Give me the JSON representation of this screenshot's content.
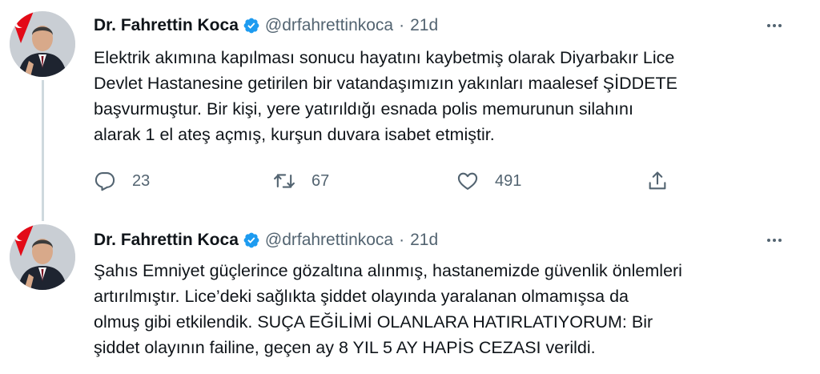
{
  "tweets": [
    {
      "author_name": "Dr. Fahrettin Koca",
      "handle": "@drfahrettinkoca",
      "separator": "·",
      "time": "21d",
      "lines": [
        "Elektrik akımına kapılması sonucu hayatını kaybetmiş olarak Diyarbakır Lice",
        "Devlet Hastanesine getirilen bir vatandaşımızın yakınları maalesef ŞİDDETE",
        "başvurmuştur. Bir kişi, yere yatırıldığı esnada polis memurunun silahını",
        "alarak 1 el ateş açmış, kurşun duvara isabet etmiştir."
      ],
      "replies": "23",
      "retweets": "67",
      "likes": "491"
    },
    {
      "author_name": "Dr. Fahrettin Koca",
      "handle": "@drfahrettinkoca",
      "separator": "·",
      "time": "21d",
      "lines": [
        "Şahıs Emniyet güçlerince gözaltına alınmış, hastanemizde güvenlik önlemleri",
        "artırılmıştır. Lice’deki sağlıkta şiddet olayında yaralanan olmamışsa da",
        "olmuş gibi etkilendik. SUÇA EĞİLİMİ OLANLARA HATIRLATIYORUM: Bir",
        "şiddet olayının failine, geçen ay 8 YIL 5 AY HAPİS CEZASI verildi."
      ]
    }
  ],
  "icons": {
    "verified": "verified-badge-icon",
    "more": "more-options-icon",
    "reply": "reply-icon",
    "retweet": "retweet-icon",
    "like": "like-heart-icon",
    "share": "share-icon"
  },
  "colors": {
    "verified": "#1d9bf0",
    "text": "#0f1419",
    "secondary": "#536471",
    "thread_line": "#cfd9de"
  }
}
